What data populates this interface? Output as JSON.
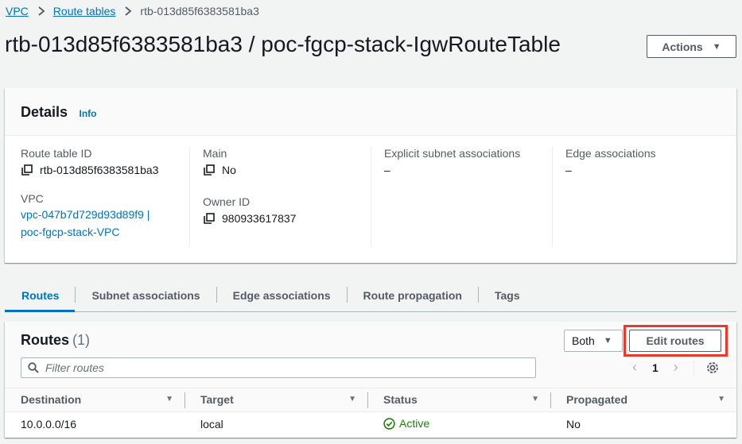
{
  "breadcrumb": {
    "items": [
      "VPC",
      "Route tables"
    ],
    "current": "rtb-013d85f6383581ba3"
  },
  "page_title": "rtb-013d85f6383581ba3 / poc-fgcp-stack-IgwRouteTable",
  "actions_label": "Actions",
  "details": {
    "title": "Details",
    "info": "Info",
    "route_table_id_label": "Route table ID",
    "route_table_id": "rtb-013d85f6383581ba3",
    "vpc_label": "VPC",
    "vpc_line1": "vpc-047b7d729d93d89f9 |",
    "vpc_line2": "poc-fgcp-stack-VPC",
    "main_label": "Main",
    "main_value": "No",
    "owner_label": "Owner ID",
    "owner_value": "980933617837",
    "explicit_label": "Explicit subnet associations",
    "explicit_value": "–",
    "edge_label": "Edge associations",
    "edge_value": "–"
  },
  "tabs": [
    "Routes",
    "Subnet associations",
    "Edge associations",
    "Route propagation",
    "Tags"
  ],
  "routes": {
    "title": "Routes",
    "count": "(1)",
    "filter_select": "Both",
    "edit_label": "Edit routes",
    "filter_placeholder": "Filter routes",
    "page": "1",
    "columns": [
      "Destination",
      "Target",
      "Status",
      "Propagated"
    ],
    "rows": [
      {
        "destination": "10.0.0.0/16",
        "target": "local",
        "status": "Active",
        "propagated": "No"
      }
    ]
  },
  "colors": {
    "link": "#0073bb",
    "status_active": "#1d8102",
    "highlight": "#e8392a"
  }
}
